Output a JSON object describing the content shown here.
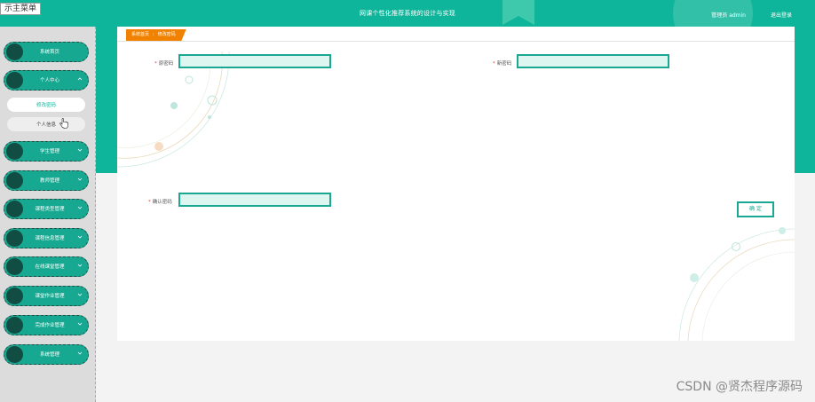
{
  "app": {
    "title": "网课个性化推荐系统的设计与实现",
    "user_text": "管理员 admin",
    "logout_label": "退出登录",
    "menu_toggle_label": "示主菜单"
  },
  "sidebar": {
    "items": [
      {
        "label": "系统首页",
        "chevron": ""
      },
      {
        "label": "个人中心",
        "chevron": "^"
      },
      {
        "label": "学生管理",
        "chevron": "v"
      },
      {
        "label": "教师管理",
        "chevron": "v"
      },
      {
        "label": "课程类型管理",
        "chevron": "v"
      },
      {
        "label": "课程信息管理",
        "chevron": "v"
      },
      {
        "label": "在线课堂管理",
        "chevron": "v"
      },
      {
        "label": "课堂作业管理",
        "chevron": "v"
      },
      {
        "label": "完成作业管理",
        "chevron": "v"
      },
      {
        "label": "系统管理",
        "chevron": "v"
      }
    ],
    "subitems": [
      {
        "label": "修改密码"
      },
      {
        "label": "个人信息"
      }
    ]
  },
  "breadcrumb": {
    "home": "系统首页",
    "separator": ":",
    "current": "修改密码"
  },
  "form": {
    "old_password": {
      "label": "原密码",
      "value": "",
      "placeholder": ""
    },
    "new_password": {
      "label": "新密码",
      "value": "",
      "placeholder": ""
    },
    "confirm_password": {
      "label": "确认密码",
      "value": "",
      "placeholder": ""
    },
    "required_mark": "*",
    "submit_label": "确 定"
  },
  "watermark": "CSDN @贤杰程序源码",
  "colors": {
    "accent": "#0fb59a",
    "sidebar_bg": "#dcdcdc",
    "nav_dot": "#114d43",
    "breadcrumb": "#f08200",
    "input_fill": "#ddf7f0"
  }
}
